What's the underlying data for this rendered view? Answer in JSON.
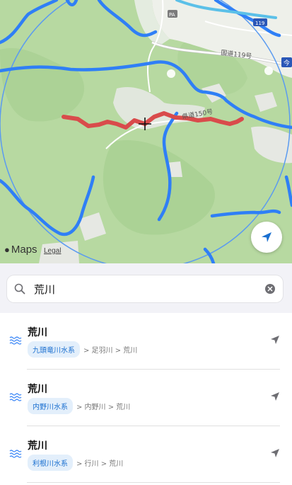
{
  "map": {
    "road_label_upper": "国道119号",
    "road_label_main": "県道150号",
    "pa_label": "PA",
    "route_shield": "119",
    "edge_badge": "今",
    "brand": "Maps",
    "legal": "Legal",
    "colors": {
      "terrain": "#b7d9a1",
      "river": "#2f7ff6",
      "highlight_route": "#d94b4b",
      "search_radius": "#5b9bf0"
    }
  },
  "search": {
    "value": "荒川",
    "icon": "search-icon",
    "clear_icon": "clear-icon"
  },
  "results": [
    {
      "name": "荒川",
      "badge": "九頭竜川水系",
      "path": "> 足羽川 > 荒川",
      "icon": "river-icon",
      "action_icon": "navigate-arrow-icon"
    },
    {
      "name": "荒川",
      "badge": "内野川水系",
      "path": "> 内野川 > 荒川",
      "icon": "river-icon",
      "action_icon": "navigate-arrow-icon"
    },
    {
      "name": "荒川",
      "badge": "利根川水系",
      "path": "> 行川 > 荒川",
      "icon": "river-icon",
      "action_icon": "navigate-arrow-icon"
    }
  ]
}
